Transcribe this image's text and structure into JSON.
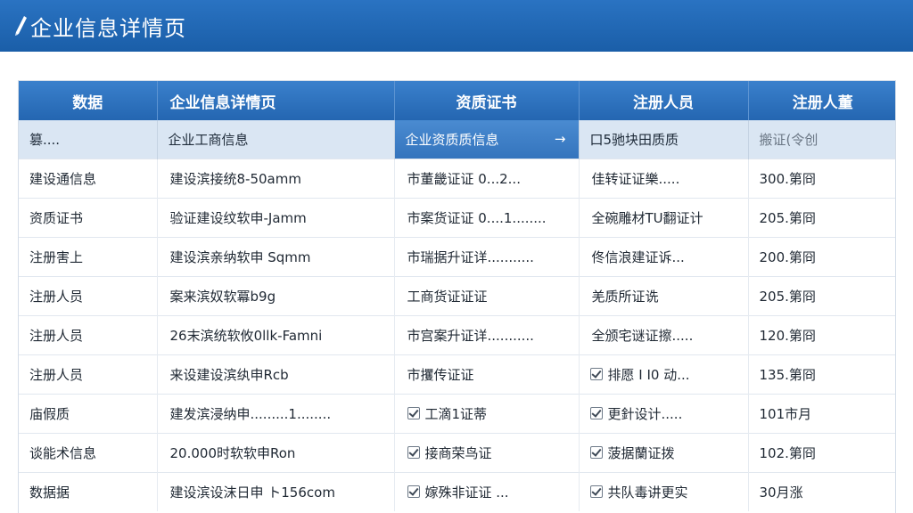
{
  "header": {
    "title": "企业信息详情页"
  },
  "table": {
    "columns": [
      "数据",
      "企业信息详情页",
      "资质证书",
      "注册人员",
      "注册人董"
    ],
    "subheader": [
      "篡....",
      "企业工商信息",
      "企业资质质信息",
      "口5驰块田质质",
      "搬证(令创"
    ],
    "active_subheader_index": 2,
    "rows": [
      {
        "c1": "建设通信息",
        "c2": "建设滨接统8-50amm",
        "c3": {
          "checked": false,
          "text": "市董畿证证 0...2..."
        },
        "c4": {
          "checked": false,
          "text": "佳转证证樂....."
        },
        "c5": "300.第冏"
      },
      {
        "c1": "资质证书",
        "c2": "验证建设纹软申-Jamm",
        "c3": {
          "checked": false,
          "text": "市案货证证 0....1........"
        },
        "c4": {
          "checked": false,
          "text": "全碗雕材TU翻证计"
        },
        "c5": "205.第冏"
      },
      {
        "c1": "注册害上",
        "c2": "建设滨亲纳软申 Sqmm",
        "c3": {
          "checked": false,
          "text": "市瑞据升证详..........."
        },
        "c4": {
          "checked": false,
          "text": "佟信浪建证诉..."
        },
        "c5": "200.第冏"
      },
      {
        "c1": "注册人员",
        "c2": "案来滨奴软冪b9g",
        "c3": {
          "checked": false,
          "text": "工商货证证证"
        },
        "c4": {
          "checked": false,
          "text": "羌质所证诜"
        },
        "c5": "205.第冏"
      },
      {
        "c1": "注册人员",
        "c2": "26末滨统软攸0llk-Famni",
        "c3": {
          "checked": false,
          "text": "市宫案升证详..........."
        },
        "c4": {
          "checked": false,
          "text": "全颁宅谜证擦....."
        },
        "c5": "120.第冏"
      },
      {
        "c1": "注册人员",
        "c2": "来设建设滨纨申Rcb",
        "c3": {
          "checked": false,
          "text": "市攫传证证"
        },
        "c4": {
          "checked": true,
          "text": "排愿 I I0 动..."
        },
        "c5": "135.第冏"
      },
      {
        "c1": "庙假质",
        "c2": "建发滨浸纳申.........1........",
        "c3": {
          "checked": true,
          "text": "工滴1证蒂"
        },
        "c4": {
          "checked": true,
          "text": "更針设计....."
        },
        "c5": "101市月"
      },
      {
        "c1": "谈能术信息",
        "c2": "20.000时软软申Ron",
        "c3": {
          "checked": true,
          "text": "接商荣鸟证"
        },
        "c4": {
          "checked": true,
          "text": "菠据蘭证拨"
        },
        "c5": "102.第冏"
      },
      {
        "c1": "数据据",
        "c2": "建设滨设沫日申 ト156com",
        "c3": {
          "checked": true,
          "text": "嫁殊非证证 ..."
        },
        "c4": {
          "checked": true,
          "text": "共队毒讲更实"
        },
        "c5": "30月涨"
      }
    ]
  },
  "colors": {
    "header_blue": "#1a5ea8",
    "table_head_blue": "#2c74c3",
    "subhead_bg": "#dae6f3",
    "active_tab_blue": "#3f82cb"
  },
  "icons": {
    "title_icon": "pen-icon",
    "active_arrow": "arrow-right-icon",
    "checkbox": "checkbox-checked-icon"
  }
}
